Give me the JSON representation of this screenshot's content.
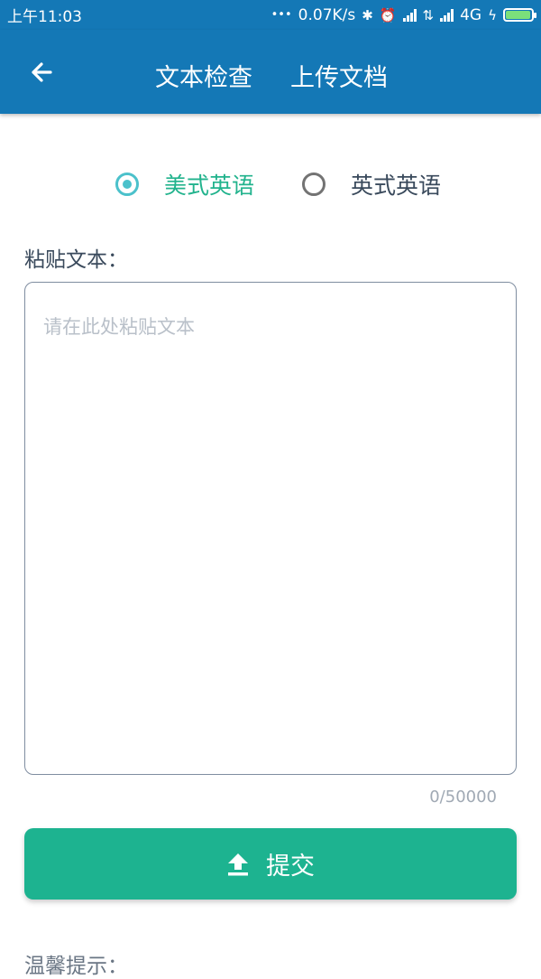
{
  "status_bar": {
    "time": "上午11:03",
    "dots": "•••",
    "net_speed": "0.07K/s",
    "network": "4G",
    "battery_level": 0.95,
    "icons": [
      "bluetooth-icon",
      "alarm-icon",
      "signal-icon",
      "data-arrows-icon",
      "signal-icon",
      "charging-icon",
      "battery-icon"
    ]
  },
  "app_bar": {
    "back_icon": "arrow-left-icon",
    "tab_text_check": "文本检查",
    "tab_upload_doc": "上传文档"
  },
  "language": {
    "options": [
      {
        "label": "美式英语",
        "selected": true
      },
      {
        "label": "英式英语",
        "selected": false
      }
    ],
    "selected_color": "#4bc1cb"
  },
  "paste": {
    "label": "粘贴文本：",
    "placeholder": "请在此处粘贴文本",
    "value": "",
    "counter": "0/50000"
  },
  "submit": {
    "label": "提交",
    "icon": "upload-icon",
    "color": "#1db390"
  },
  "tip": {
    "label": "温馨提示："
  },
  "colors": {
    "primary": "#1478b6",
    "accent": "#1db390"
  }
}
